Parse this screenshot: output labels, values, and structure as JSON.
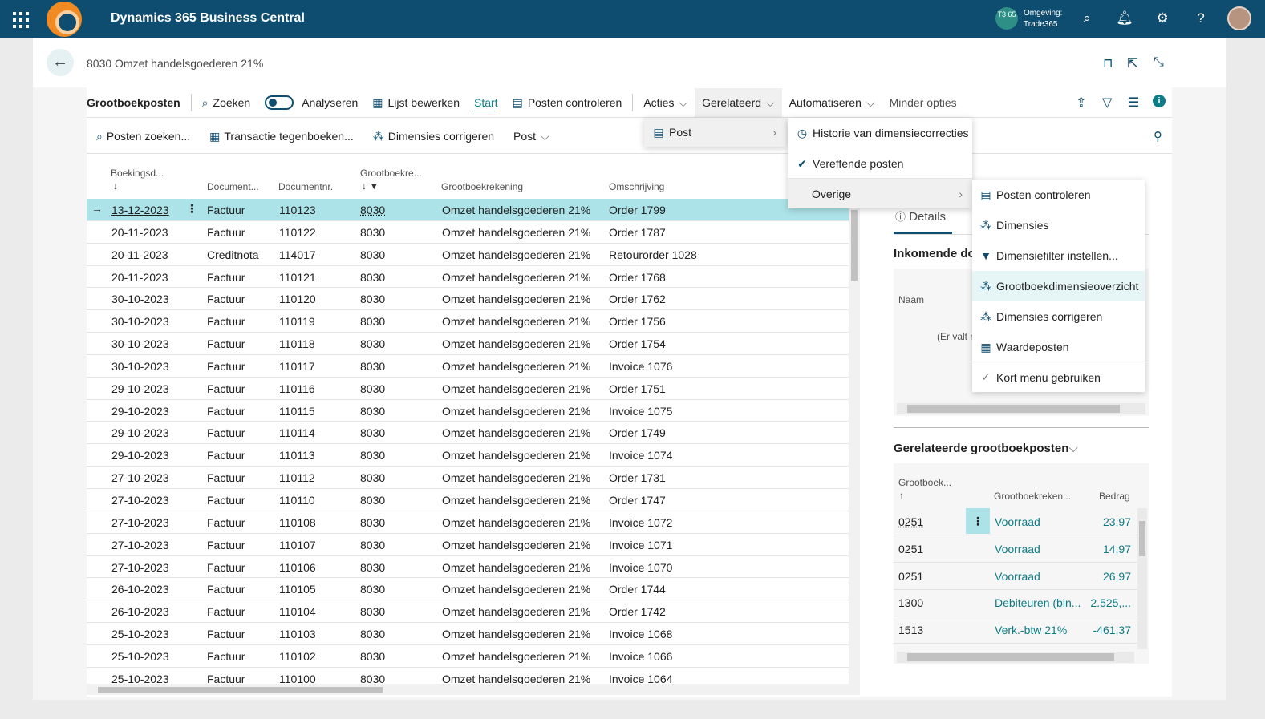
{
  "topbar": {
    "app_title": "Dynamics 365 Business Central",
    "env_badge": "T3 65",
    "env_label": "Omgeving:",
    "env_name": "Trade365",
    "icons": [
      "search-icon",
      "bell-icon",
      "gear-icon",
      "help-icon"
    ]
  },
  "header": {
    "page_title": "8030 Omzet handelsgoederen 21%"
  },
  "actionbar": {
    "page_name": "Grootboekposten",
    "search": "Zoeken",
    "analyze": "Analyseren",
    "edit_list": "Lijst bewerken",
    "start": "Start",
    "check_entries": "Posten controleren",
    "actions": "Acties",
    "related": "Gerelateerd",
    "automate": "Automatiseren",
    "fewer": "Minder opties"
  },
  "subbar": {
    "find_entries": "Posten zoeken...",
    "reverse": "Transactie tegenboeken...",
    "correct_dims": "Dimensies corrigeren",
    "post": "Post"
  },
  "columns": {
    "date": "Boekingsd...",
    "doctype": "Document...",
    "docno": "Documentnr.",
    "accno": "Grootboekre...",
    "accname": "Grootboekrekening",
    "desc": "Omschrijving"
  },
  "rows": [
    {
      "date": "13-12-2023",
      "doctype": "Factuur",
      "docno": "110123",
      "acc": "8030",
      "accname": "Omzet handelsgoederen 21%",
      "desc": "Order 1799"
    },
    {
      "date": "20-11-2023",
      "doctype": "Factuur",
      "docno": "110122",
      "acc": "8030",
      "accname": "Omzet handelsgoederen 21%",
      "desc": "Order 1787"
    },
    {
      "date": "20-11-2023",
      "doctype": "Creditnota",
      "docno": "114017",
      "acc": "8030",
      "accname": "Omzet handelsgoederen 21%",
      "desc": "Retourorder 1028"
    },
    {
      "date": "20-11-2023",
      "doctype": "Factuur",
      "docno": "110121",
      "acc": "8030",
      "accname": "Omzet handelsgoederen 21%",
      "desc": "Order 1768"
    },
    {
      "date": "30-10-2023",
      "doctype": "Factuur",
      "docno": "110120",
      "acc": "8030",
      "accname": "Omzet handelsgoederen 21%",
      "desc": "Order 1762"
    },
    {
      "date": "30-10-2023",
      "doctype": "Factuur",
      "docno": "110119",
      "acc": "8030",
      "accname": "Omzet handelsgoederen 21%",
      "desc": "Order 1756"
    },
    {
      "date": "30-10-2023",
      "doctype": "Factuur",
      "docno": "110118",
      "acc": "8030",
      "accname": "Omzet handelsgoederen 21%",
      "desc": "Order 1754"
    },
    {
      "date": "30-10-2023",
      "doctype": "Factuur",
      "docno": "110117",
      "acc": "8030",
      "accname": "Omzet handelsgoederen 21%",
      "desc": "Invoice 1076"
    },
    {
      "date": "29-10-2023",
      "doctype": "Factuur",
      "docno": "110116",
      "acc": "8030",
      "accname": "Omzet handelsgoederen 21%",
      "desc": "Order 1751"
    },
    {
      "date": "29-10-2023",
      "doctype": "Factuur",
      "docno": "110115",
      "acc": "8030",
      "accname": "Omzet handelsgoederen 21%",
      "desc": "Invoice 1075"
    },
    {
      "date": "29-10-2023",
      "doctype": "Factuur",
      "docno": "110114",
      "acc": "8030",
      "accname": "Omzet handelsgoederen 21%",
      "desc": "Order 1749"
    },
    {
      "date": "29-10-2023",
      "doctype": "Factuur",
      "docno": "110113",
      "acc": "8030",
      "accname": "Omzet handelsgoederen 21%",
      "desc": "Invoice 1074"
    },
    {
      "date": "27-10-2023",
      "doctype": "Factuur",
      "docno": "110112",
      "acc": "8030",
      "accname": "Omzet handelsgoederen 21%",
      "desc": "Order 1731"
    },
    {
      "date": "27-10-2023",
      "doctype": "Factuur",
      "docno": "110110",
      "acc": "8030",
      "accname": "Omzet handelsgoederen 21%",
      "desc": "Order 1747"
    },
    {
      "date": "27-10-2023",
      "doctype": "Factuur",
      "docno": "110108",
      "acc": "8030",
      "accname": "Omzet handelsgoederen 21%",
      "desc": "Invoice 1072"
    },
    {
      "date": "27-10-2023",
      "doctype": "Factuur",
      "docno": "110107",
      "acc": "8030",
      "accname": "Omzet handelsgoederen 21%",
      "desc": "Invoice 1071"
    },
    {
      "date": "27-10-2023",
      "doctype": "Factuur",
      "docno": "110106",
      "acc": "8030",
      "accname": "Omzet handelsgoederen 21%",
      "desc": "Invoice 1070"
    },
    {
      "date": "26-10-2023",
      "doctype": "Factuur",
      "docno": "110105",
      "acc": "8030",
      "accname": "Omzet handelsgoederen 21%",
      "desc": "Order 1744"
    },
    {
      "date": "26-10-2023",
      "doctype": "Factuur",
      "docno": "110104",
      "acc": "8030",
      "accname": "Omzet handelsgoederen 21%",
      "desc": "Order 1742"
    },
    {
      "date": "25-10-2023",
      "doctype": "Factuur",
      "docno": "110103",
      "acc": "8030",
      "accname": "Omzet handelsgoederen 21%",
      "desc": "Invoice 1068"
    },
    {
      "date": "25-10-2023",
      "doctype": "Factuur",
      "docno": "110102",
      "acc": "8030",
      "accname": "Omzet handelsgoederen 21%",
      "desc": "Invoice 1066"
    },
    {
      "date": "25-10-2023",
      "doctype": "Factuur",
      "docno": "110100",
      "acc": "8030",
      "accname": "Omzet handelsgoederen 21%",
      "desc": "Invoice 1064"
    }
  ],
  "factbox": {
    "details_tab": "Details",
    "incoming_title": "Inkomende do",
    "name_col": "Naam",
    "empty_text": "(Er valt n",
    "related_title": "Gerelateerde grootboekposten",
    "cols": {
      "acc": "Grootboek...",
      "accname": "Grootboekreken...",
      "amount": "Bedrag"
    },
    "rows": [
      {
        "acc": "0251",
        "name": "Voorraad",
        "amount": "23,97"
      },
      {
        "acc": "0251",
        "name": "Voorraad",
        "amount": "14,97"
      },
      {
        "acc": "0251",
        "name": "Voorraad",
        "amount": "26,97"
      },
      {
        "acc": "1300",
        "name": "Debiteuren (bin...",
        "amount": "2.525,..."
      },
      {
        "acc": "1513",
        "name": "Verk.-btw 21%",
        "amount": "-461,37"
      }
    ]
  },
  "menu_related": {
    "post": "Post"
  },
  "menu_post": {
    "history": "Historie van dimensiecorrecties",
    "applied": "Vereffende posten",
    "other": "Overige"
  },
  "menu_other": {
    "items": [
      "Posten controleren",
      "Dimensies",
      "Dimensiefilter instellen...",
      "Grootboekdimensieoverzicht",
      "Dimensies corrigeren",
      "Waardeposten",
      "Kort menu gebruiken"
    ]
  }
}
